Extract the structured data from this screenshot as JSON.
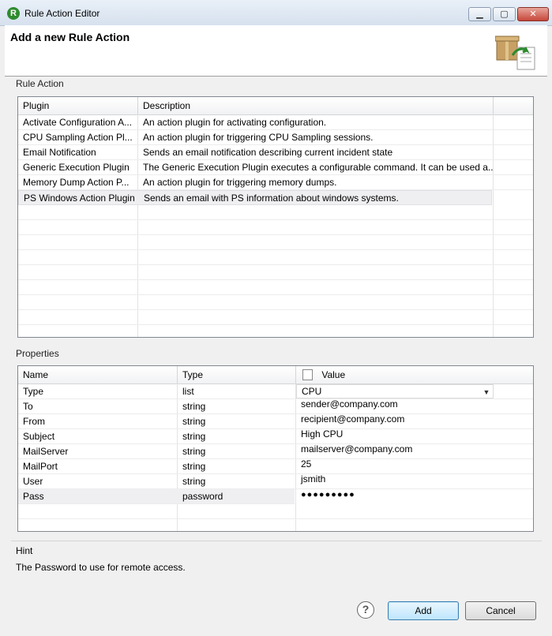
{
  "window": {
    "title": "Rule Action Editor",
    "app_icon_letter": "R"
  },
  "header": {
    "title": "Add a new Rule Action"
  },
  "rule_action": {
    "group_label": "Rule Action",
    "columns": [
      "Plugin",
      "Description"
    ],
    "rows": [
      {
        "plugin": "Activate Configuration A...",
        "description": "An action plugin for activating configuration."
      },
      {
        "plugin": "CPU Sampling Action Pl...",
        "description": "An action plugin for triggering CPU Sampling sessions."
      },
      {
        "plugin": "Email Notification",
        "description": "Sends an email notification describing current incident state"
      },
      {
        "plugin": "Generic Execution Plugin",
        "description": "The Generic Execution Plugin executes a configurable command. It can be used a..."
      },
      {
        "plugin": "Memory Dump Action P...",
        "description": "An action plugin for triggering memory dumps."
      },
      {
        "plugin": "PS Windows Action Plugin",
        "description": "Sends an email with PS information about windows systems."
      }
    ],
    "selected_index": 5
  },
  "properties": {
    "group_label": "Properties",
    "columns": [
      "Name",
      "Type",
      "Value"
    ],
    "rows": [
      {
        "name": "Type",
        "type": "list",
        "value": "CPU"
      },
      {
        "name": "To",
        "type": "string",
        "value": "sender@company.com"
      },
      {
        "name": "From",
        "type": "string",
        "value": "recipient@company.com"
      },
      {
        "name": "Subject",
        "type": "string",
        "value": "High CPU"
      },
      {
        "name": "MailServer",
        "type": "string",
        "value": "mailserver@company.com"
      },
      {
        "name": "MailPort",
        "type": "string",
        "value": "25"
      },
      {
        "name": "User",
        "type": "string",
        "value": "jsmith"
      },
      {
        "name": "Pass",
        "type": "password",
        "value": "●●●●●●●●●"
      }
    ],
    "selected_index": 7
  },
  "hint": {
    "label": "Hint",
    "text": "The Password to use for remote access."
  },
  "buttons": {
    "add": "Add",
    "cancel": "Cancel",
    "help": "?"
  }
}
